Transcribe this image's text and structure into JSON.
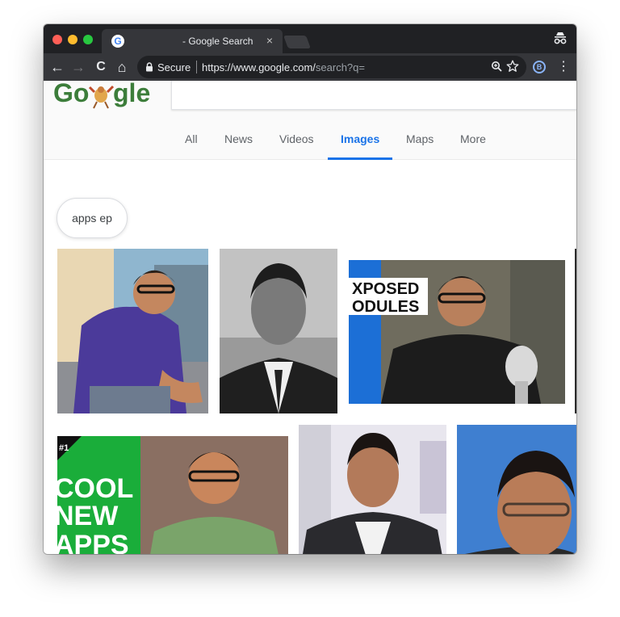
{
  "browser": {
    "tab_title": "- Google Search",
    "tab_close": "×",
    "favicon": "G",
    "toolbar": {
      "back": "←",
      "forward": "→",
      "reload": "C",
      "home": "⌂",
      "secure_label": "Secure",
      "url_host": "https://www.google.com/",
      "url_path": "search?q=",
      "extension_badge": "B",
      "menu": "⋮"
    }
  },
  "google": {
    "nav_tabs": [
      "All",
      "News",
      "Videos",
      "Images",
      "Maps",
      "More"
    ],
    "active_tab": "Images",
    "chip_label": "apps ep"
  },
  "images": [
    {
      "banner": ""
    },
    {
      "banner": ""
    },
    {
      "banner_lines": [
        "XPOSED",
        "ODULES"
      ]
    },
    {
      "banner": ""
    },
    {
      "banner_lines": [
        "#1",
        "COOL",
        "NEW",
        "APPS"
      ]
    },
    {
      "banner": ""
    },
    {
      "banner": ""
    },
    {
      "banner": ""
    }
  ],
  "colors": {
    "chrome_dark": "#202124",
    "toolbar": "#35363a",
    "accent_blue": "#1a73e8",
    "banner_green": "#1aad3a"
  }
}
